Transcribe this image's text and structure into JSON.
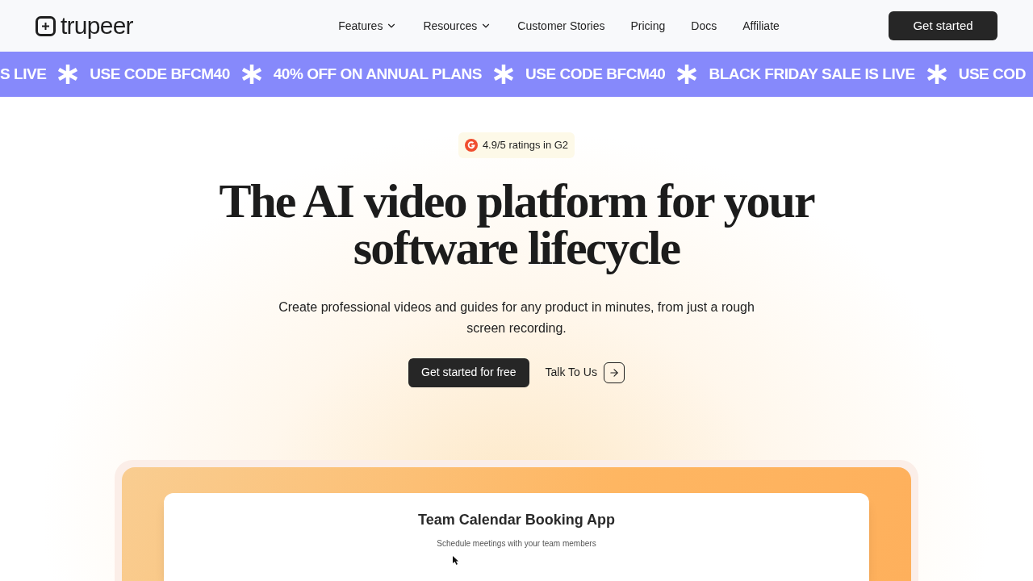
{
  "nav": {
    "logo": "trupeer",
    "items": [
      {
        "label": "Features",
        "dropdown": true
      },
      {
        "label": "Resources",
        "dropdown": true
      },
      {
        "label": "Customer Stories",
        "dropdown": false
      },
      {
        "label": "Pricing",
        "dropdown": false
      },
      {
        "label": "Docs",
        "dropdown": false
      },
      {
        "label": "Affiliate",
        "dropdown": false
      }
    ],
    "cta": "Get started"
  },
  "banner": [
    "S LIVE",
    "USE CODE BFCM40",
    "40% OFF ON ANNUAL PLANS",
    "USE CODE BFCM40",
    "BLACK FRIDAY SALE IS LIVE",
    "USE COD"
  ],
  "hero": {
    "rating": "4.9/5 ratings in G2",
    "title_lines": [
      "The AI video platform for your",
      "software lifecycle"
    ],
    "subtitle": "Create professional videos and guides for any product in minutes, from just a rough screen recording.",
    "primary": "Get started for free",
    "secondary": "Talk To Us"
  },
  "demo": {
    "title": "Team Calendar Booking App",
    "subtitle": "Schedule meetings with your team members"
  }
}
